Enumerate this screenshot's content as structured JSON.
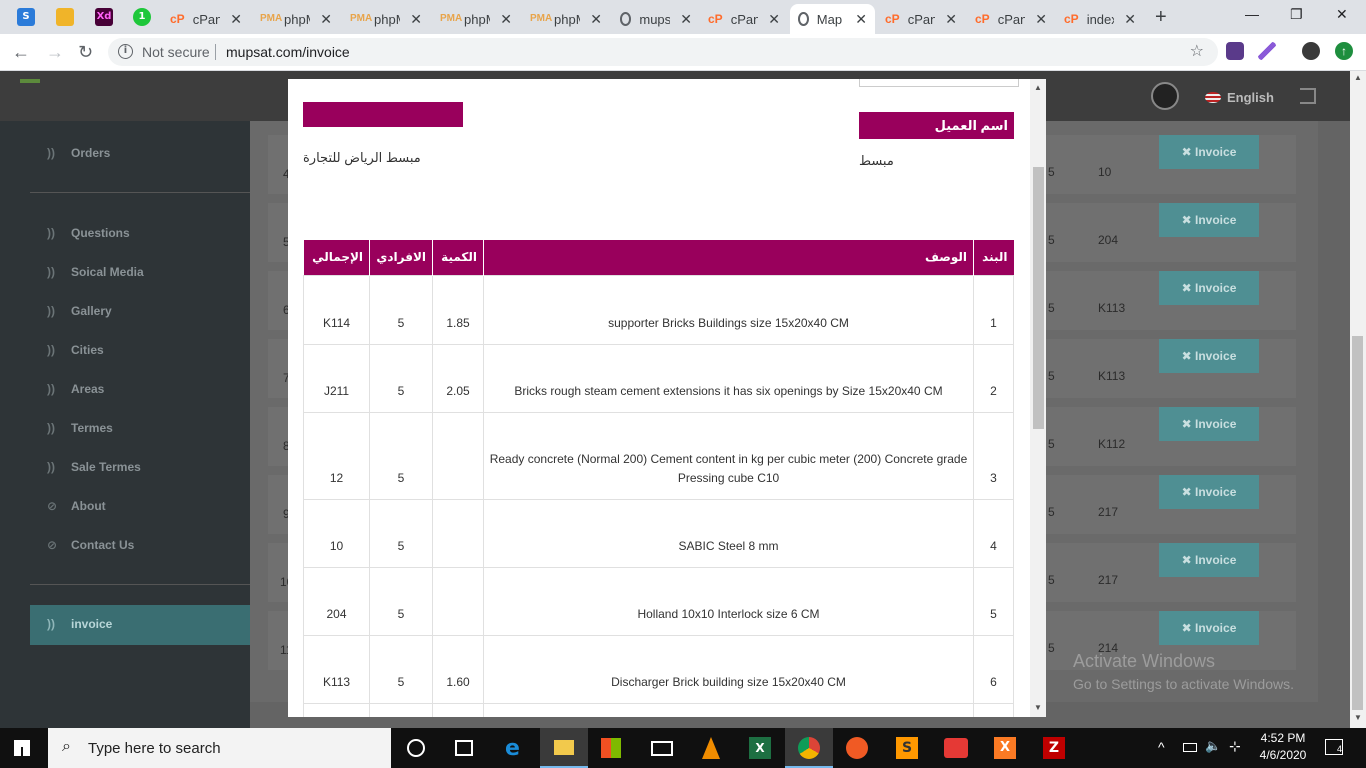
{
  "browser": {
    "tabs": [
      {
        "label": "cPanel",
        "icon": "cp"
      },
      {
        "label": "phpMyAdmin",
        "icon": "pma"
      },
      {
        "label": "phpMyAdmin",
        "icon": "pma"
      },
      {
        "label": "phpMyAdmin",
        "icon": "pma"
      },
      {
        "label": "phpMyAdmin",
        "icon": "pma"
      },
      {
        "label": "mupsat",
        "icon": "globe"
      },
      {
        "label": "cPanel",
        "icon": "cp"
      },
      {
        "label": "Map",
        "icon": "globe",
        "active": true
      },
      {
        "label": "cPanel",
        "icon": "cp"
      },
      {
        "label": "cPanel",
        "icon": "cp"
      },
      {
        "label": "index",
        "icon": "cp"
      }
    ],
    "security": "Not secure",
    "url": "mupsat.com/invoice"
  },
  "header": {
    "language": "English"
  },
  "sidebar": {
    "items": [
      {
        "label": "Orders"
      },
      {
        "label": "Questions"
      },
      {
        "label": "Soical Media"
      },
      {
        "label": "Gallery"
      },
      {
        "label": "Cities"
      },
      {
        "label": "Areas"
      },
      {
        "label": "Termes"
      },
      {
        "label": "Sale Termes"
      },
      {
        "label": "About"
      },
      {
        "label": "Contact Us"
      }
    ],
    "active": "invoice"
  },
  "background_rows": [
    {
      "num": "4",
      "five": "5",
      "value": "10"
    },
    {
      "num": "5",
      "five": "5",
      "value": "204"
    },
    {
      "num": "6",
      "five": "5",
      "value": "K113"
    },
    {
      "num": "7",
      "five": "5",
      "value": "K113"
    },
    {
      "num": "8",
      "five": "5",
      "value": "K112"
    },
    {
      "num": "9",
      "five": "5",
      "value": "217"
    },
    {
      "num": "10",
      "five": "5",
      "value": "217"
    },
    {
      "num": "11",
      "five": "5",
      "value": "214"
    }
  ],
  "invoice_button_label": "✖ Invoice",
  "watermark": {
    "line1": "Activate Windows",
    "line2": "Go to Settings to activate Windows."
  },
  "modal": {
    "company": "مبسط الرياض للتجارة",
    "client_label": "اسم العميل",
    "client_name": "مبسط",
    "table": {
      "headers": [
        "البند",
        "الوصف",
        "الكمية",
        "الافرادي",
        "الإجمالي"
      ],
      "rows": [
        {
          "n": "1",
          "desc": "supporter Bricks Buildings size 15x20x40 CM",
          "qty": "1.85",
          "unit": "5",
          "total": "K114"
        },
        {
          "n": "2",
          "desc": "Bricks rough steam cement extensions it has six openings by Size 15x20x40 CM",
          "qty": "2.05",
          "unit": "5",
          "total": "J211"
        },
        {
          "n": "3",
          "desc": "Ready concrete (Normal 200) Cement content in kg per cubic meter (200) Concrete grade Pressing cube C10",
          "qty": "",
          "unit": "5",
          "total": "12"
        },
        {
          "n": "4",
          "desc": "SABIC Steel 8 mm",
          "qty": "",
          "unit": "5",
          "total": "10"
        },
        {
          "n": "5",
          "desc": "Holland 10x10 Interlock size 6 CM",
          "qty": "",
          "unit": "5",
          "total": "204"
        },
        {
          "n": "6",
          "desc": "Discharger Brick building size 15x20x40 CM",
          "qty": "1.60",
          "unit": "5",
          "total": "K113"
        }
      ]
    }
  },
  "taskbar": {
    "search_placeholder": "Type here to search",
    "time": "4:52 PM",
    "date": "4/6/2020",
    "notifications": "4"
  }
}
